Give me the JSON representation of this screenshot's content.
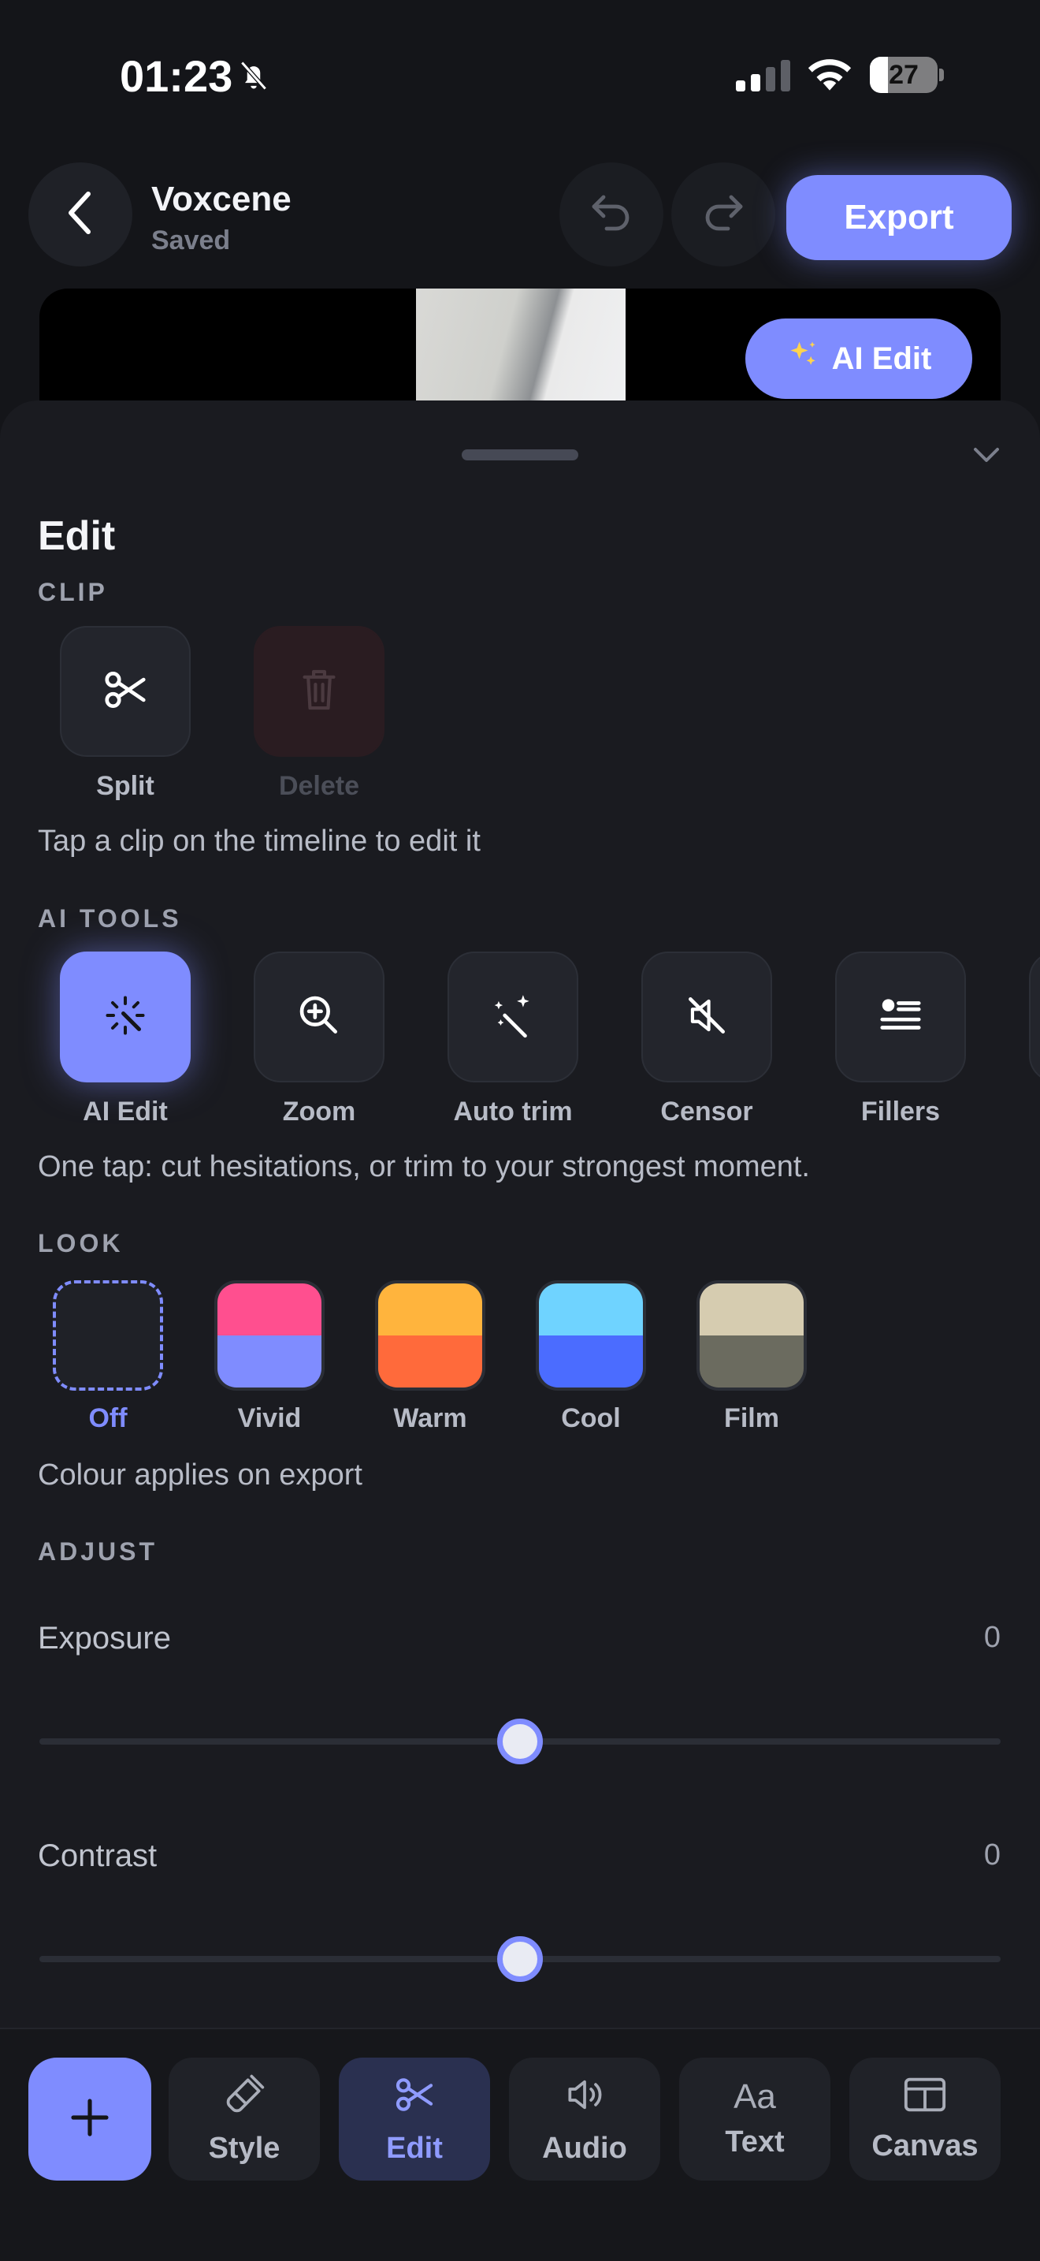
{
  "status_bar": {
    "time": "01:23",
    "battery": "27",
    "battery_level": 0.27
  },
  "header": {
    "title": "Voxcene",
    "status": "Saved",
    "export_label": "Export",
    "ai_edit_label": "AI Edit"
  },
  "sheet": {
    "title": "Edit",
    "clip": {
      "label": "CLIP",
      "tools": [
        {
          "label": "Split",
          "icon": "scissors-icon",
          "enabled": true
        },
        {
          "label": "Delete",
          "icon": "trash-icon",
          "enabled": false
        }
      ],
      "hint": "Tap a clip on the timeline to edit it"
    },
    "ai_tools": {
      "label": "AI TOOLS",
      "tools": [
        {
          "label": "AI Edit",
          "icon": "sparkle-wand-icon",
          "active": true
        },
        {
          "label": "Zoom",
          "icon": "zoom-in-icon"
        },
        {
          "label": "Auto trim",
          "icon": "magic-wand-icon"
        },
        {
          "label": "Censor",
          "icon": "mute-icon"
        },
        {
          "label": "Fillers",
          "icon": "fillers-icon"
        }
      ],
      "hint": "One tap: cut hesitations, or trim to your strongest moment."
    },
    "look": {
      "label": "LOOK",
      "swatches": [
        {
          "label": "Off",
          "selected": true
        },
        {
          "label": "Vivid",
          "top": "#ff4f8f",
          "bottom": "#7f8cff"
        },
        {
          "label": "Warm",
          "top": "#ffb43d",
          "bottom": "#ff6a3b"
        },
        {
          "label": "Cool",
          "top": "#6fd3ff",
          "bottom": "#4b6cff"
        },
        {
          "label": "Film",
          "top": "#d6ccb0",
          "bottom": "#6b6b5f"
        }
      ],
      "hint": "Colour applies on export"
    },
    "adjust": {
      "label": "ADJUST",
      "sliders": [
        {
          "label": "Exposure",
          "value": "0",
          "position": 0.5
        },
        {
          "label": "Contrast",
          "value": "0",
          "position": 0.5
        }
      ]
    }
  },
  "bottom_nav": {
    "tabs": [
      {
        "label": "Style",
        "icon": "paintbrush-icon"
      },
      {
        "label": "Edit",
        "icon": "scissors-icon",
        "active": true
      },
      {
        "label": "Audio",
        "icon": "speaker-icon"
      },
      {
        "label": "Text",
        "icon": "text-icon",
        "glyph": "Aa"
      },
      {
        "label": "Canvas",
        "icon": "canvas-icon"
      }
    ]
  },
  "colors": {
    "accent": "#7f8cff",
    "background": "#141519",
    "sheet": "#1a1b20"
  }
}
